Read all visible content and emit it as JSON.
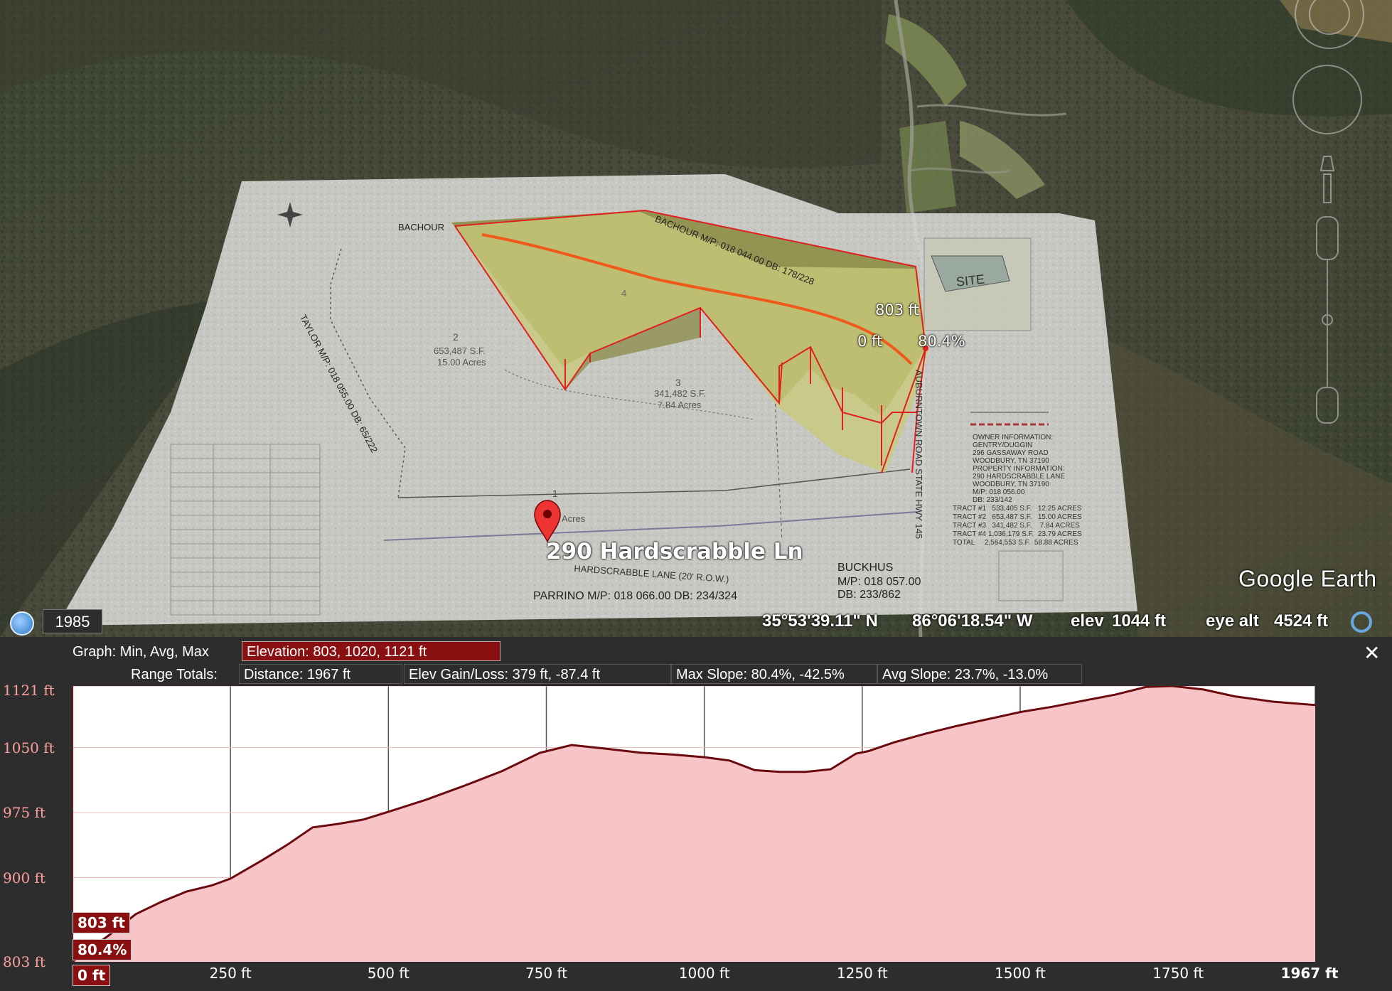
{
  "map": {
    "address": "290 Hardscrabble Ln",
    "year": "1985",
    "latitude": "35°53'39.11\" N",
    "longitude": "86°06'18.54\" W",
    "elev_label": "elev",
    "elev_value": "1044 ft",
    "eye_alt_label": "eye alt",
    "eye_alt_value": "4524 ft",
    "brand": "Google Earth",
    "overlay_markers": {
      "elevation": "803 ft",
      "distance": "0 ft",
      "slope": "80.4%"
    },
    "plat": {
      "bachour_left": "BACHOUR",
      "bachour_top": "BACHOUR M/P: 018 044.00 DB: 178/228",
      "taylor": "TAYLOR M/P: 018 055.00 DB: 65/222",
      "tract2": "2",
      "tract2_area": "653,487 S.F.",
      "tract2_acres": "15.00 Acres",
      "tract3": "3",
      "tract3_area": "341,482 S.F.",
      "tract3_acres": "7.84 Acres",
      "tract1": "1",
      "tract1_acres": "Acres",
      "tract4": "4",
      "site": "SITE",
      "road": "AUBURNTOWN ROAD STATE HWY 145",
      "lane": "HARDSCRABBLE LANE (20' R.O.W.)",
      "parrino": "PARRINO M/P: 018 066.00 DB: 234/324",
      "buckhus": "BUCKHUS",
      "buckhus_mp": "M/P: 018 057.00",
      "buckhus_db": "DB: 233/862",
      "owner_info": [
        "OWNER INFORMATION:",
        "GENTRY/DUGGIN",
        "296 GASSAWAY ROAD",
        "WOODBURY, TN 37190",
        "PROPERTY INFORMATION:",
        "290 HARDSCRABBLE LANE",
        "WOODBURY, TN 37190",
        "M/P: 018 056.00",
        "DB: 233/142"
      ],
      "tract_table": [
        "TRACT #1   533,405 S.F.   12.25 ACRES",
        "TRACT #2   653,487 S.F.   15.00 ACRES",
        "TRACT #3   341,482 S.F.    7.84 ACRES",
        "TRACT #4 1,036,179 S.F.  23.79 ACRES",
        "TOTAL     2,564,553 S.F.  58.88 ACRES"
      ]
    }
  },
  "profile": {
    "graph_label": "Graph: Min, Avg, Max",
    "elevation_stat": "Elevation: 803, 1020, 1121 ft",
    "range_totals_label": "Range Totals:",
    "distance": "Distance: 1967 ft",
    "elev_gain_loss": "Elev Gain/Loss: 379 ft, -87.4 ft",
    "max_slope": "Max Slope: 80.4%, -42.5%",
    "avg_slope": "Avg Slope: 23.7%, -13.0%",
    "close_icon": "✕",
    "cursor_elev": "803 ft",
    "cursor_slope": "80.4%",
    "cursor_dist": "0 ft"
  },
  "chart_data": {
    "type": "area",
    "xlabel": "",
    "ylabel": "",
    "xlim": [
      0,
      1967
    ],
    "ylim": [
      803,
      1121
    ],
    "x_ticks": [
      {
        "v": 0,
        "label": "0 ft"
      },
      {
        "v": 250,
        "label": "250 ft"
      },
      {
        "v": 500,
        "label": "500 ft"
      },
      {
        "v": 750,
        "label": "750 ft"
      },
      {
        "v": 1000,
        "label": "1000 ft"
      },
      {
        "v": 1250,
        "label": "1250 ft"
      },
      {
        "v": 1500,
        "label": "1500 ft"
      },
      {
        "v": 1750,
        "label": "1750 ft"
      },
      {
        "v": 1967,
        "label": "1967 ft"
      }
    ],
    "y_ticks": [
      {
        "v": 803,
        "label": "803 ft"
      },
      {
        "v": 900,
        "label": "900 ft"
      },
      {
        "v": 975,
        "label": "975 ft"
      },
      {
        "v": 1050,
        "label": "1050 ft"
      },
      {
        "v": 1121,
        "label": "1121 ft"
      }
    ],
    "fill_color": "#f7c4c7",
    "line_color": "#6b0a0e",
    "x": [
      0,
      60,
      100,
      140,
      180,
      220,
      250,
      300,
      340,
      380,
      420,
      460,
      500,
      560,
      620,
      680,
      740,
      790,
      840,
      900,
      950,
      1000,
      1040,
      1080,
      1120,
      1160,
      1200,
      1240,
      1260,
      1300,
      1350,
      1400,
      1450,
      1500,
      1550,
      1600,
      1650,
      1700,
      1740,
      1790,
      1840,
      1900,
      1967
    ],
    "y": [
      803,
      835,
      858,
      872,
      884,
      891,
      899,
      920,
      938,
      958,
      962,
      967,
      976,
      990,
      1006,
      1023,
      1044,
      1053,
      1049,
      1044,
      1042,
      1039,
      1035,
      1024,
      1022,
      1022,
      1025,
      1043,
      1046,
      1056,
      1066,
      1075,
      1083,
      1091,
      1097,
      1104,
      1111,
      1120,
      1121,
      1117,
      1109,
      1103,
      1099
    ]
  }
}
